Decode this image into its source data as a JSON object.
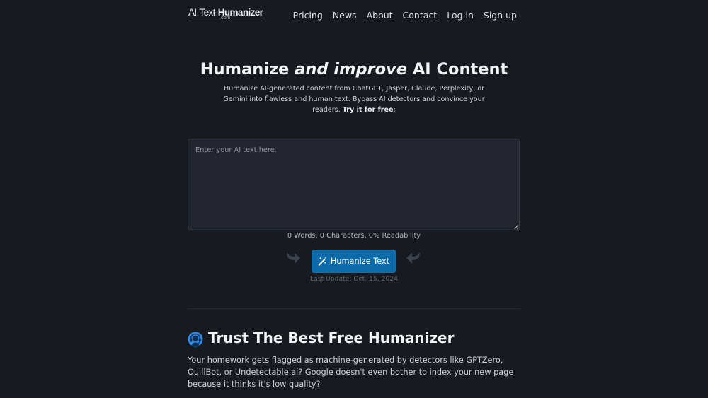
{
  "header": {
    "logo": {
      "prefix": "AI-Text-",
      "brand": "Humanizer",
      "suffix": ".com"
    },
    "nav": [
      "Pricing",
      "News",
      "About",
      "Contact",
      "Log in",
      "Sign up"
    ]
  },
  "hero": {
    "title_start": "Humanize ",
    "title_emphasis": "and improve",
    "title_end": " AI Content",
    "subtitle": "Humanize AI-generated content from ChatGPT, Jasper, Claude, Perplexity, or Gemini into flawless and human text. Bypass AI detectors and convince your readers. ",
    "subtitle_cta": "Try it for free",
    "subtitle_end": ":"
  },
  "editor": {
    "placeholder": "Enter your AI text here.",
    "value": "",
    "stats": "0 Words, 0 Characters, 0% Readability"
  },
  "action": {
    "button_label": "Humanize Text",
    "button_icon": "magic-wand-icon",
    "last_update": "Last Update: Oct. 15, 2024"
  },
  "trust": {
    "icon": "support-headset-icon",
    "title": "Trust The Best Free Humanizer",
    "body": "Your homework gets flagged as machine-generated by detectors like GPTZero, QuillBot, or Undetectable.ai? Google doesn't even bother to index your new page because it thinks it's low quality?"
  },
  "colors": {
    "background": "#171a21",
    "input_background": "#212631",
    "accent": "#0c6ba8",
    "icon_blue": "#2e8ce6"
  }
}
